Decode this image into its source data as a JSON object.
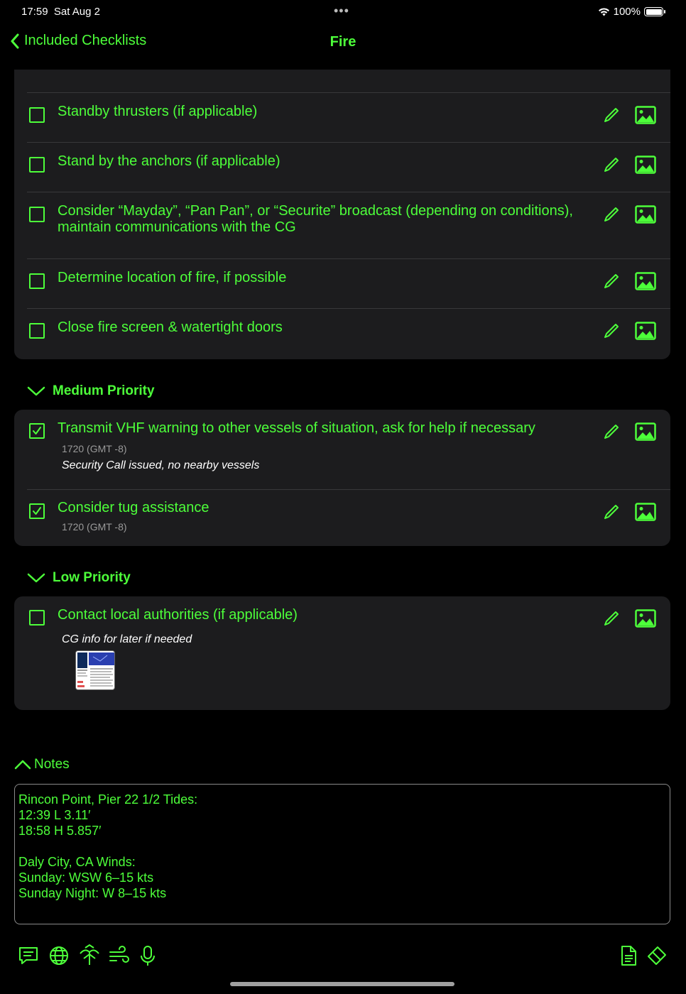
{
  "status_bar": {
    "time": "17:59",
    "date": "Sat Aug 2",
    "battery": "100%"
  },
  "nav": {
    "back_label": "Included Checklists",
    "title": "Fire"
  },
  "high_items": [
    {
      "text": "Standby thrusters (if applicable)",
      "checked": false
    },
    {
      "text": "Stand by the anchors (if applicable)",
      "checked": false
    },
    {
      "text": "Consider “Mayday”, “Pan Pan”, or “Securite” broadcast (depending on conditions), maintain communications with the CG",
      "checked": false
    },
    {
      "text": "Determine location of fire, if possible",
      "checked": false
    },
    {
      "text": "Close fire screen & watertight doors",
      "checked": false
    }
  ],
  "medium": {
    "header": "Medium Priority",
    "items": [
      {
        "text": "Transmit VHF warning to other vessels of situation, ask for help if necessary",
        "checked": true,
        "time": "1720 (GMT -8)",
        "note": "Security Call issued, no nearby vessels"
      },
      {
        "text": "Consider tug assistance",
        "checked": true,
        "time": "1720 (GMT -8)"
      }
    ]
  },
  "low": {
    "header": "Low Priority",
    "items": [
      {
        "text": "Contact local authorities (if applicable)",
        "checked": false,
        "note": "CG info for later if needed"
      }
    ]
  },
  "notes": {
    "header": "Notes",
    "text": "Rincon Point, Pier 22 1/2 Tides:\n12:39 L 3.11′\n18:58 H 5.857′\n\nDaly City, CA Winds:\nSunday: WSW 6–15 kts\nSunday Night: W 8–15 kts"
  },
  "toolbar": {
    "left_icons": [
      "message-icon",
      "globe-icon",
      "tide-icon",
      "wind-icon",
      "microphone-icon"
    ],
    "right_icons": [
      "document-icon",
      "eraser-icon"
    ]
  },
  "colors": {
    "accent": "#4dff3a",
    "background": "#000000",
    "card": "#1c1c1e",
    "divider": "#38383a"
  }
}
